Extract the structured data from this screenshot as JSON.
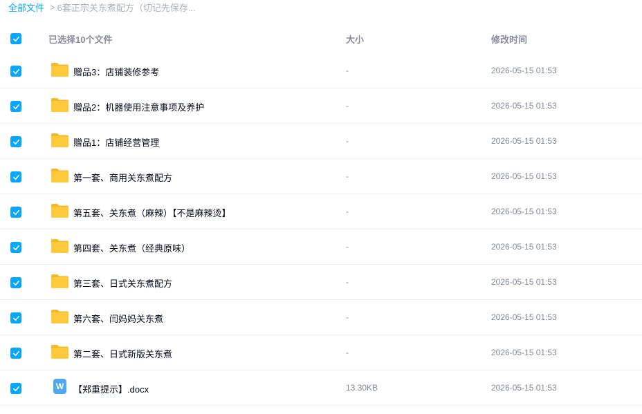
{
  "breadcrumb": {
    "root": "全部文件",
    "separator": ">",
    "current": "6套正宗关东煮配方（切记先保存..."
  },
  "header": {
    "selection_label": "已选择10个文件",
    "size_label": "大小",
    "time_label": "修改时间"
  },
  "colors": {
    "accent": "#06a7ff",
    "folder": "#ffc93c",
    "doc": "#4ea8f3"
  },
  "files": [
    {
      "icon": "folder-icon",
      "name": "赠品3：店铺装修参考",
      "size": "-",
      "time": "2026-05-15 01:53",
      "checked": true
    },
    {
      "icon": "folder-icon",
      "name": "赠品2：机器使用注意事项及养护",
      "size": "-",
      "time": "2026-05-15 01:53",
      "checked": true
    },
    {
      "icon": "folder-icon",
      "name": "赠品1：店铺经营管理",
      "size": "-",
      "time": "2026-05-15 01:53",
      "checked": true
    },
    {
      "icon": "folder-icon",
      "name": "第一套、商用关东煮配方",
      "size": "-",
      "time": "2026-05-15 01:53",
      "checked": true
    },
    {
      "icon": "folder-icon",
      "name": "第五套、关东煮（麻辣）【不是麻辣烫】",
      "size": "-",
      "time": "2026-05-15 01:53",
      "checked": true
    },
    {
      "icon": "folder-icon",
      "name": "第四套、关东煮（经典原味）",
      "size": "-",
      "time": "2026-05-15 01:53",
      "checked": true
    },
    {
      "icon": "folder-icon",
      "name": "第三套、日式关东煮配方",
      "size": "-",
      "time": "2026-05-15 01:53",
      "checked": true
    },
    {
      "icon": "folder-icon",
      "name": "第六套、闫妈妈关东煮",
      "size": "-",
      "time": "2026-05-15 01:53",
      "checked": true
    },
    {
      "icon": "folder-icon",
      "name": "第二套、日式新版关东煮",
      "size": "-",
      "time": "2026-05-15 01:53",
      "checked": true
    },
    {
      "icon": "word-doc-icon",
      "icon_letter": "W",
      "name": "【郑重提示】.docx",
      "size": "13.30KB",
      "time": "2026-05-15 01:53",
      "checked": true
    }
  ]
}
